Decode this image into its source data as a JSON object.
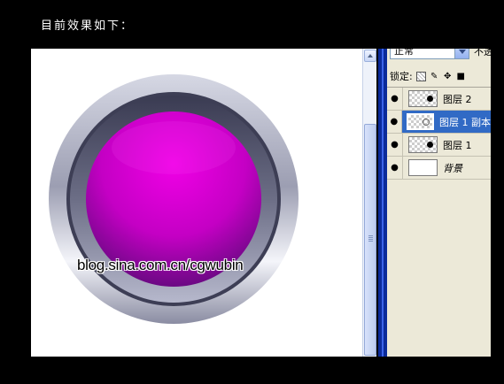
{
  "caption": "目前效果如下：",
  "canvas": {
    "watermark": "blog.sina.com.cn/cgwubin",
    "button_color": "#e000d8"
  },
  "scrollbar": {
    "up_icon": "arrow-up-icon"
  },
  "layers_panel": {
    "blend_mode": "正常",
    "opacity_label": "不透",
    "lock_label": "锁定:",
    "lock_icons": [
      "lock-transparency-icon",
      "brush-icon",
      "move-icon",
      "lock-icon"
    ],
    "layers": [
      {
        "name": "图层 2",
        "selected": false,
        "thumb": "dot"
      },
      {
        "name": "图层 1 副本",
        "selected": true,
        "thumb": "ring"
      },
      {
        "name": "图层 1",
        "selected": false,
        "thumb": "dot"
      },
      {
        "name": "背景",
        "selected": false,
        "thumb": "white"
      }
    ]
  },
  "colors": {
    "selection": "#316ac5",
    "panel_bg": "#ece9d8",
    "divider": "#0a2a9a"
  }
}
